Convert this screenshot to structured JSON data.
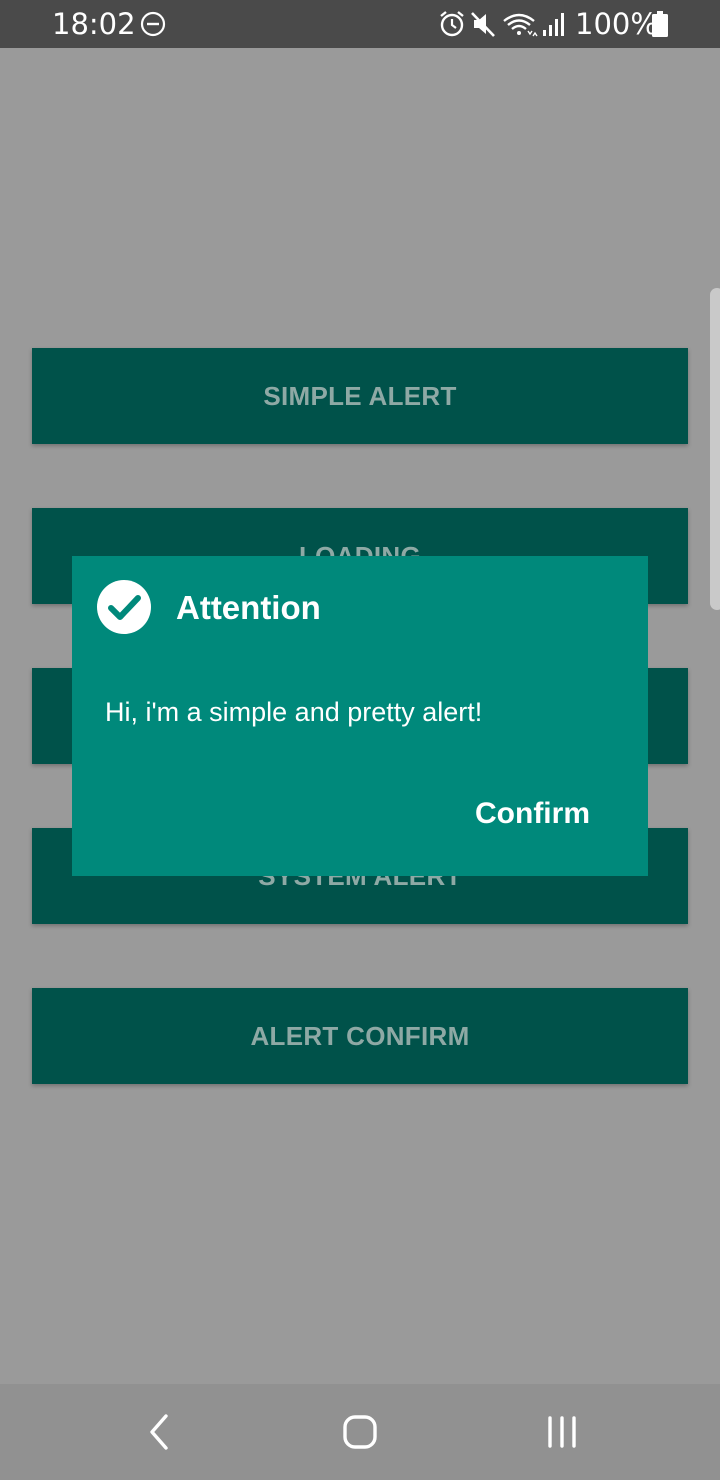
{
  "status_bar": {
    "time": "18:02",
    "battery_percent": "100%",
    "icons": [
      "do-not-disturb-icon",
      "alarm-icon",
      "mute-icon",
      "wifi-icon",
      "signal-icon",
      "battery-icon"
    ]
  },
  "buttons": [
    {
      "label": "SIMPLE ALERT"
    },
    {
      "label": "LOADING"
    },
    {
      "label": ""
    },
    {
      "label": "SYSTEM ALERT"
    },
    {
      "label": "ALERT CONFIRM"
    }
  ],
  "dialog": {
    "icon": "check-circle-icon",
    "title": "Attention",
    "message": "Hi, i'm a simple and pretty alert!",
    "confirm_label": "Confirm"
  },
  "nav_bar": {
    "icons": [
      "back-icon",
      "home-icon",
      "recents-icon"
    ]
  },
  "colors": {
    "scrim_background": "#9a9a9a",
    "button_background": "#00524a",
    "button_text": "#8ea9a5",
    "dialog_background": "#00897b",
    "status_bar": "#4a4a4a",
    "nav_bar": "#919191"
  }
}
